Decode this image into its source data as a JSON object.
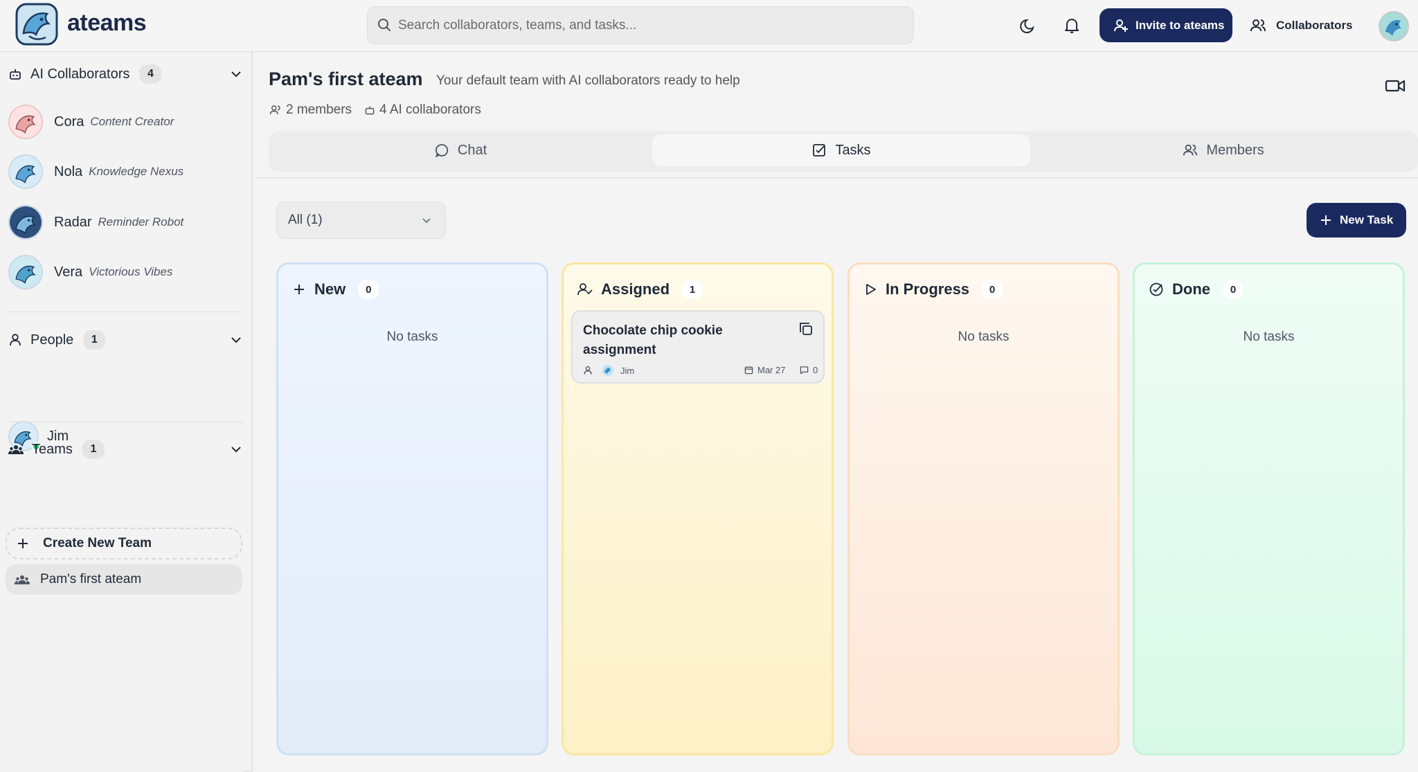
{
  "app": {
    "brand": "ateams"
  },
  "search": {
    "placeholder": "Search collaborators, teams, and tasks..."
  },
  "topbar": {
    "invite_label": "Invite to ateams",
    "collaborators_label": "Collaborators"
  },
  "sidebar": {
    "ai_section": {
      "title": "AI Collaborators",
      "count": "4",
      "items": [
        {
          "name": "Cora",
          "role": "Content Creator"
        },
        {
          "name": "Nola",
          "role": "Knowledge Nexus"
        },
        {
          "name": "Radar",
          "role": "Reminder Robot"
        },
        {
          "name": "Vera",
          "role": "Victorious Vibes"
        }
      ]
    },
    "people_section": {
      "title": "People",
      "count": "1",
      "items": [
        {
          "name": "Jim"
        }
      ]
    },
    "teams_section": {
      "title": "Teams",
      "count": "1",
      "create_label": "Create New Team",
      "items": [
        {
          "name": "Pam's first ateam"
        }
      ]
    }
  },
  "main": {
    "title": "Pam's first ateam",
    "subtitle": "Your default team with AI collaborators ready to help",
    "members_meta": "2 members",
    "ai_meta": "4 AI collaborators",
    "tabs": [
      {
        "label": "Chat",
        "active": false
      },
      {
        "label": "Tasks",
        "active": true
      },
      {
        "label": "Members",
        "active": false
      }
    ],
    "filter_value": "All (1)",
    "new_task_label": "New Task"
  },
  "board": {
    "columns": [
      {
        "title": "New",
        "count": "0",
        "empty_text": "No tasks"
      },
      {
        "title": "Assigned",
        "count": "1",
        "empty_text": ""
      },
      {
        "title": "In Progress",
        "count": "0",
        "empty_text": "No tasks"
      },
      {
        "title": "Done",
        "count": "0",
        "empty_text": "No tasks"
      }
    ],
    "task": {
      "title": "Chocolate chip cookie assignment",
      "assignee": "Jim",
      "due": "Mar 27",
      "comments": "0"
    }
  },
  "colors": {
    "accent": "#1b2a5e",
    "new": "#e8f0fc",
    "assigned": "#fdf4d2",
    "in_progress": "#fdeee2",
    "done": "#dff9ec"
  }
}
